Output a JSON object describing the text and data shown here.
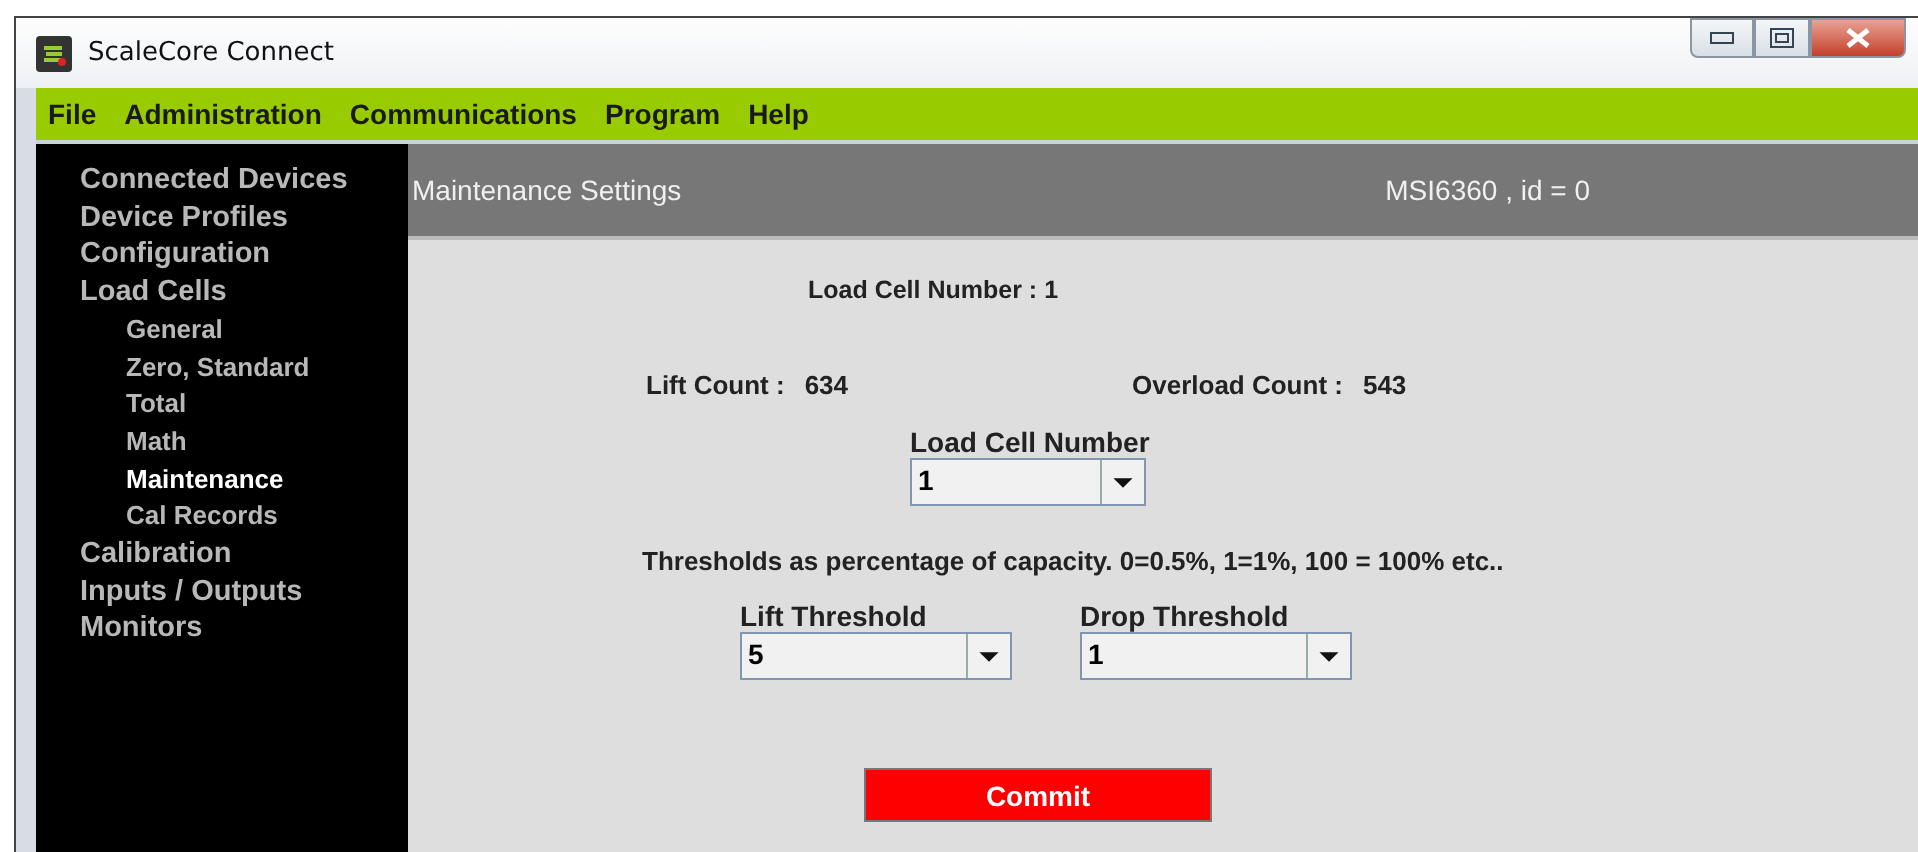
{
  "window": {
    "title": "ScaleCore Connect"
  },
  "menu": [
    "File",
    "Administration",
    "Communications",
    "Program",
    "Help"
  ],
  "sidebar": {
    "items": [
      {
        "label": "Connected Devices",
        "selected": false
      },
      {
        "label": "Device Profiles",
        "selected": false
      },
      {
        "label": "Configuration",
        "selected": false
      },
      {
        "label": "Load Cells",
        "selected": false,
        "children": [
          {
            "label": "General",
            "selected": false
          },
          {
            "label": "Zero, Standard",
            "selected": false
          },
          {
            "label": "Total",
            "selected": false
          },
          {
            "label": "Math",
            "selected": false
          },
          {
            "label": "Maintenance",
            "selected": true
          },
          {
            "label": "Cal Records",
            "selected": false
          }
        ]
      },
      {
        "label": "Calibration",
        "selected": false
      },
      {
        "label": "Inputs / Outputs",
        "selected": false
      },
      {
        "label": "Monitors",
        "selected": false
      }
    ]
  },
  "header": {
    "title": "Maintenance Settings",
    "device": "MSI6360 , id = 0"
  },
  "load_cell_heading": "Load Cell Number : 1",
  "counts": [
    {
      "label": "Lift Count :",
      "value": "634"
    },
    {
      "label": "Overload Count :",
      "value": "543"
    }
  ],
  "load_cell_select": {
    "label": "Load Cell Number",
    "value": "1"
  },
  "note": "Thresholds as percentage of capacity. 0=0.5%, 1=1%, 100 = 100% etc..",
  "thresholds": [
    {
      "label": "Lift Threshold",
      "value": "5"
    },
    {
      "label": "Drop Threshold",
      "value": "1"
    }
  ],
  "commit_button": "Commit"
}
